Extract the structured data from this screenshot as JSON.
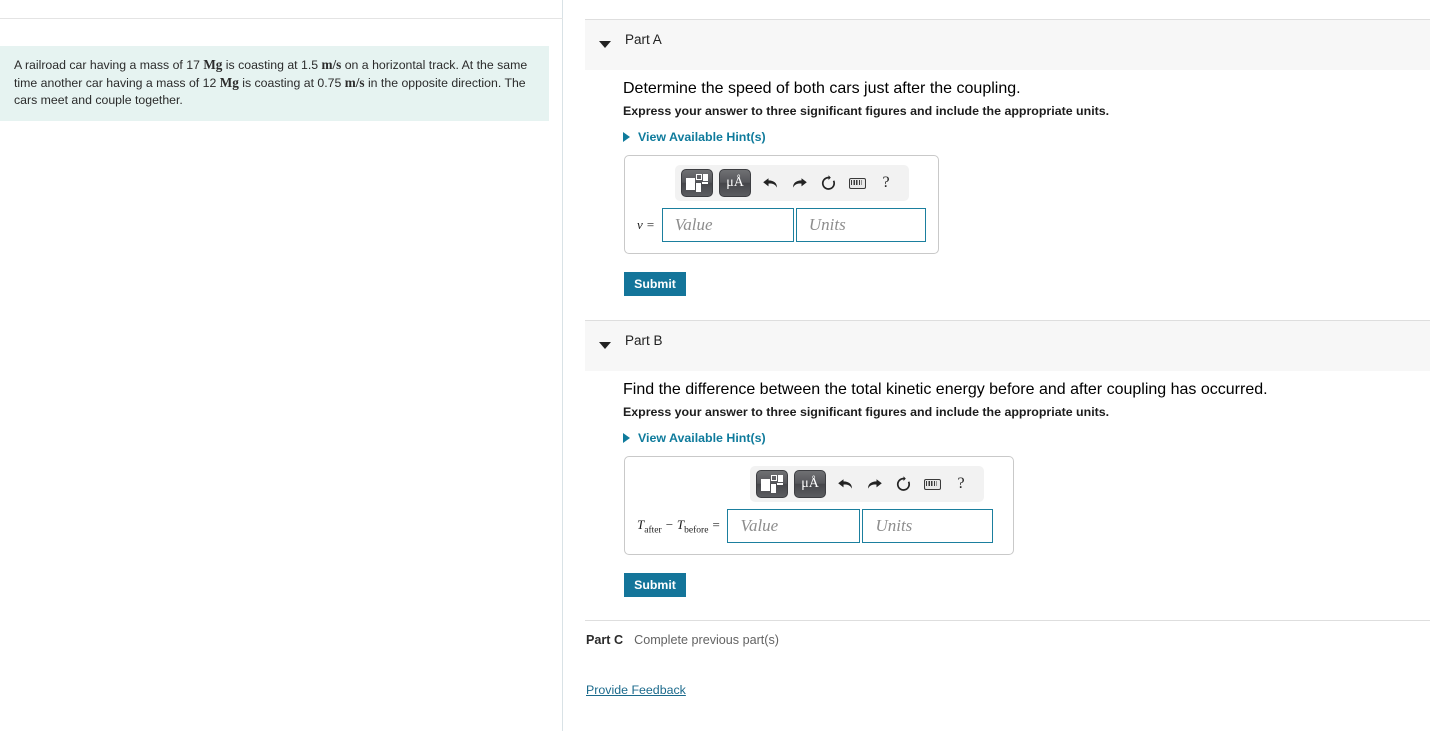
{
  "problem": {
    "text_parts": [
      "A railroad car having a mass of 17 ",
      "Mg",
      " is coasting at 1.5 ",
      "m/s",
      " on a horizontal track. At the same time another car having a mass of 12 ",
      "Mg",
      " is coasting at 0.75 ",
      "m/s",
      " in the opposite direction. The cars meet and couple together."
    ],
    "seg1": "A railroad car having a mass of 17 ",
    "unit1": "Mg",
    "seg2": " is coasting at 1.5 ",
    "unit2": "m/s",
    "seg3": " on a horizontal track. At the same time another car having a mass of 12 ",
    "unit3": "Mg",
    "seg4": " is coasting at 0.75 ",
    "unit4": "m/s",
    "seg5": " in the opposite direction. The cars meet and couple together."
  },
  "parts": {
    "a": {
      "title": "Part A",
      "question": "Determine the speed of both cars just after the coupling.",
      "instruction": "Express your answer to three significant figures and include the appropriate units.",
      "hints_label": "View Available Hint(s)",
      "equation_label": "v =",
      "value_placeholder": "Value",
      "units_placeholder": "Units",
      "submit_label": "Submit"
    },
    "b": {
      "title": "Part B",
      "question": "Find the difference between the total kinetic energy before and after coupling has occurred.",
      "instruction": "Express your answer to three significant figures and include the appropriate units.",
      "hints_label": "View Available Hint(s)",
      "equation_label_main": "T",
      "equation_sub_after": "after",
      "equation_label_minus": " − T",
      "equation_sub_before": "before",
      "equation_label_eq": " =",
      "value_placeholder": "Value",
      "units_placeholder": "Units",
      "submit_label": "Submit"
    },
    "c": {
      "title": "Part C",
      "status": "Complete previous part(s)"
    }
  },
  "toolbar": {
    "template_icon": "math-template-icon",
    "units_icon": "μÅ",
    "undo_icon": "↶",
    "redo_icon": "↷",
    "reset_icon": "↻",
    "keyboard_icon": "keyboard-icon",
    "help_icon": "?"
  },
  "footer": {
    "feedback_label": "Provide Feedback"
  },
  "colors": {
    "accent_teal": "#14759a",
    "link_teal": "#0f7b9c",
    "problem_bg": "#e6f3f1",
    "band_bg": "#f7f7f7",
    "field_border": "#1b7f9e"
  }
}
